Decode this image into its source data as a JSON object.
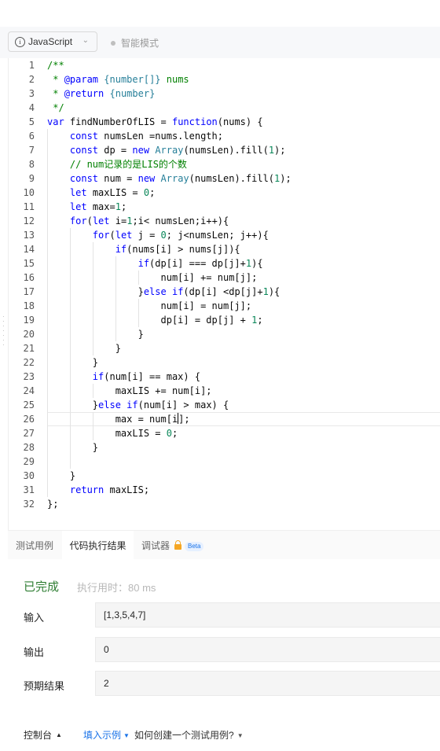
{
  "toolbar": {
    "language": "JavaScript",
    "mode": "智能模式"
  },
  "editor": {
    "lines": [
      "/**",
      " * @param {number[]} nums",
      " * @return {number}",
      " */",
      "var findNumberOfLIS = function(nums) {",
      "    const numsLen =nums.length;",
      "    const dp = new Array(numsLen).fill(1);",
      "    // num记录的是LIS的个数",
      "    const num = new Array(numsLen).fill(1);",
      "    let maxLIS = 0;",
      "    let max=1;",
      "    for(let i=1;i< numsLen;i++){",
      "        for(let j = 0; j<numsLen; j++){",
      "            if(nums[i] > nums[j]){",
      "                if(dp[i] === dp[j]+1){",
      "                    num[i] += num[j];",
      "                }else if(dp[i] <dp[j]+1){",
      "                    num[i] = num[j];",
      "                    dp[i] = dp[j] + 1;",
      "                }",
      "            }",
      "        }",
      "        if(num[i] == max) {",
      "            maxLIS += num[i];",
      "        }else if(num[i] > max) {",
      "            max = num[i];",
      "            maxLIS = 0;",
      "        }",
      "",
      "    }",
      "    return maxLIS;",
      "};"
    ],
    "active_line": 26
  },
  "panel": {
    "tabs": [
      "测试用例",
      "代码执行结果",
      "调试器"
    ],
    "beta": "Beta",
    "status": "已完成",
    "exec_time_label": "执行用时：",
    "exec_time": "80 ms",
    "rows": [
      {
        "label": "输入",
        "value": "[1,3,5,4,7]"
      },
      {
        "label": "输出",
        "value": "0"
      },
      {
        "label": "预期结果",
        "value": "2"
      }
    ]
  },
  "footer": {
    "console": "控制台",
    "fill_example": "填入示例",
    "howto": "如何创建一个测试用例?"
  },
  "colors": {
    "status_green": "#2e7d32",
    "link_blue": "#1a73e8",
    "lock_orange": "#f5a623"
  }
}
